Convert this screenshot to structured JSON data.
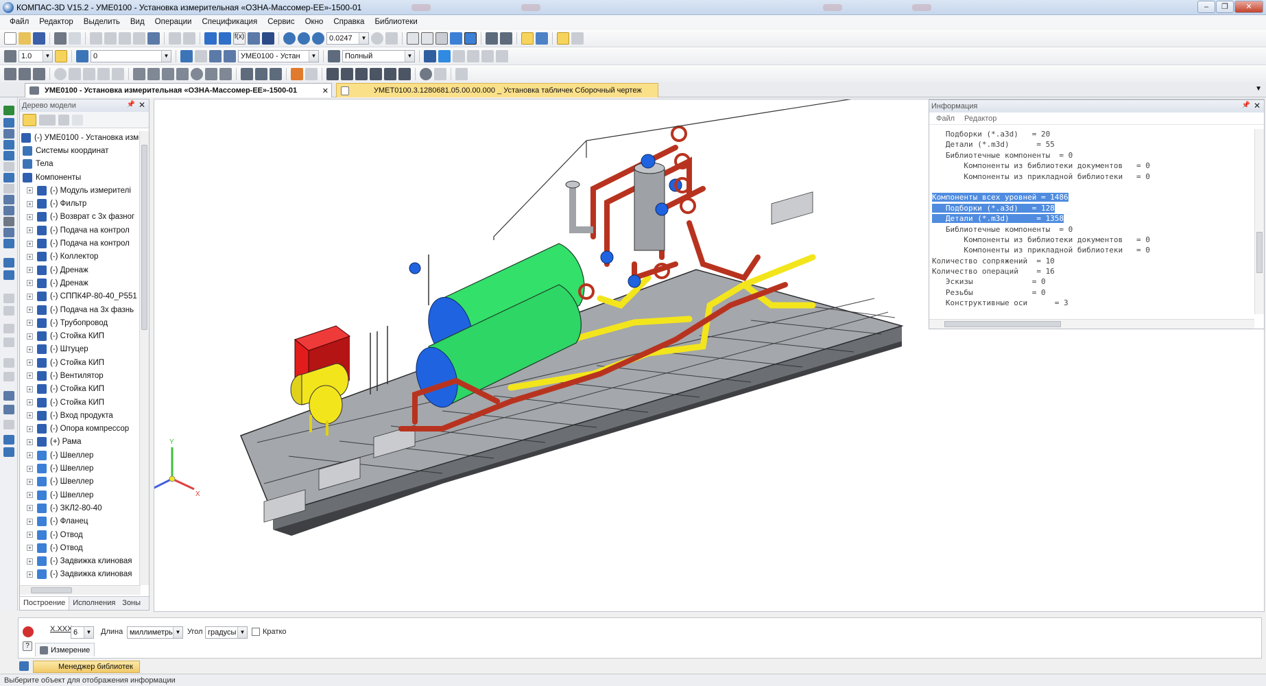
{
  "window": {
    "title": "КОМПАС-3D V15.2  - УМЕ0100 - Установка измерительная «ОЗНА-Массомер-ЕЕ»-1500-01"
  },
  "menu": [
    "Файл",
    "Редактор",
    "Выделить",
    "Вид",
    "Операции",
    "Спецификация",
    "Сервис",
    "Окно",
    "Справка",
    "Библиотеки"
  ],
  "toolbar1": {
    "zoom_value": "0.0247"
  },
  "toolbar2": {
    "step_value": "1.0",
    "layer_value": "0",
    "component_combo": "УМЕ0100 - Устан",
    "view_mode": "Полный"
  },
  "doc_tabs": [
    {
      "label": "УМЕ0100 - Установка измерительная «ОЗНА-Массомер-ЕЕ»-1500-01",
      "active": true
    },
    {
      "label": "УМЕТ0100.3.1280681.05.00.00.000 _ Установка табличек Сборочный чертеж",
      "active": false
    }
  ],
  "tree_panel": {
    "header": "Дерево модели",
    "items": [
      {
        "label": "(-) УМЕ0100 - Установка измер",
        "level": 0,
        "expander": "",
        "icon": "assembly-icon"
      },
      {
        "label": "Системы координат",
        "level": 1,
        "expander": "",
        "icon": "coordinate-systems-icon"
      },
      {
        "label": "Тела",
        "level": 1,
        "expander": "",
        "icon": "bodies-icon"
      },
      {
        "label": "Компоненты",
        "level": 1,
        "expander": "",
        "icon": "components-icon"
      },
      {
        "label": "(-) Модуль измерителі",
        "level": 2,
        "expander": "+",
        "icon": "assembly-icon"
      },
      {
        "label": "(-) Фильтр",
        "level": 2,
        "expander": "+",
        "icon": "assembly-icon"
      },
      {
        "label": "(-) Возврат с 3х фазног",
        "level": 2,
        "expander": "+",
        "icon": "assembly-icon"
      },
      {
        "label": "(-) Подача на контрол",
        "level": 2,
        "expander": "+",
        "icon": "assembly-icon"
      },
      {
        "label": "(-) Подача на контрол",
        "level": 2,
        "expander": "+",
        "icon": "assembly-icon"
      },
      {
        "label": "(-) Коллектор",
        "level": 2,
        "expander": "+",
        "icon": "assembly-icon"
      },
      {
        "label": "(-) Дренаж",
        "level": 2,
        "expander": "+",
        "icon": "assembly-icon"
      },
      {
        "label": "(-) Дренаж",
        "level": 2,
        "expander": "+",
        "icon": "assembly-icon"
      },
      {
        "label": "(-) СППК4Р-80-40_Р551",
        "level": 2,
        "expander": "+",
        "icon": "assembly-icon"
      },
      {
        "label": "(-) Подача на 3х фазнь",
        "level": 2,
        "expander": "+",
        "icon": "assembly-icon"
      },
      {
        "label": "(-) Трубопровод",
        "level": 2,
        "expander": "+",
        "icon": "assembly-icon"
      },
      {
        "label": "(-) Стойка КИП",
        "level": 2,
        "expander": "+",
        "icon": "assembly-icon"
      },
      {
        "label": "(-) Штуцер",
        "level": 2,
        "expander": "+",
        "icon": "assembly-icon"
      },
      {
        "label": "(-) Стойка КИП",
        "level": 2,
        "expander": "+",
        "icon": "assembly-icon"
      },
      {
        "label": "(-) Вентилятор",
        "level": 2,
        "expander": "+",
        "icon": "assembly-icon"
      },
      {
        "label": "(-) Стойка КИП",
        "level": 2,
        "expander": "+",
        "icon": "assembly-icon"
      },
      {
        "label": "(-) Стойка КИП",
        "level": 2,
        "expander": "+",
        "icon": "assembly-icon"
      },
      {
        "label": "(-) Вход продукта",
        "level": 2,
        "expander": "+",
        "icon": "assembly-icon"
      },
      {
        "label": "(-) Опора компрессор",
        "level": 2,
        "expander": "+",
        "icon": "assembly-icon"
      },
      {
        "label": "(+) Рама",
        "level": 2,
        "expander": "+",
        "icon": "assembly-icon"
      },
      {
        "label": "(-) Швеллер",
        "level": 2,
        "expander": "+",
        "icon": "part-icon"
      },
      {
        "label": "(-) Швеллер",
        "level": 2,
        "expander": "+",
        "icon": "part-icon"
      },
      {
        "label": "(-) Швеллер",
        "level": 2,
        "expander": "+",
        "icon": "part-icon"
      },
      {
        "label": "(-) Швеллер",
        "level": 2,
        "expander": "+",
        "icon": "part-icon"
      },
      {
        "label": "(-) ЗКЛ2-80-40",
        "level": 2,
        "expander": "+",
        "icon": "part-icon"
      },
      {
        "label": "(-) Фланец",
        "level": 2,
        "expander": "+",
        "icon": "part-icon"
      },
      {
        "label": "(-) Отвод",
        "level": 2,
        "expander": "+",
        "icon": "part-icon"
      },
      {
        "label": "(-) Отвод",
        "level": 2,
        "expander": "+",
        "icon": "part-icon"
      },
      {
        "label": "(-) Задвижка клиновая",
        "level": 2,
        "expander": "+",
        "icon": "part-icon"
      },
      {
        "label": "(-) Задвижка клиновая",
        "level": 2,
        "expander": "+",
        "icon": "part-icon"
      }
    ],
    "bottom_tabs": [
      "Построение",
      "Исполнения",
      "Зоны"
    ]
  },
  "info_panel": {
    "header": "Информация",
    "menu": [
      "Файл",
      "Редактор"
    ],
    "lines": [
      {
        "text": "   Подборки (*.a3d)   = 20",
        "selected": false
      },
      {
        "text": "   Детали (*.m3d)      = 55",
        "selected": false
      },
      {
        "text": "   Библиотечные компоненты  = 0",
        "selected": false
      },
      {
        "text": "       Компоненты из библиотеки документов   = 0",
        "selected": false
      },
      {
        "text": "       Компоненты из прикладной библиотеки   = 0",
        "selected": false
      },
      {
        "text": "",
        "selected": false
      },
      {
        "text": "Компоненты всех уровней = 1486",
        "selected": true
      },
      {
        "text": "   Подборки (*.a3d)   = 128",
        "selected": true
      },
      {
        "text": "   Детали (*.m3d)      = 1358",
        "selected": true
      },
      {
        "text": "   Библиотечные компоненты  = 0",
        "selected": false
      },
      {
        "text": "       Компоненты из библиотеки документов   = 0",
        "selected": false
      },
      {
        "text": "       Компоненты из прикладной библиотеки   = 0",
        "selected": false
      },
      {
        "text": "Количество сопряжений  = 10",
        "selected": false
      },
      {
        "text": "Количество операций    = 16",
        "selected": false
      },
      {
        "text": "   Эскизы             = 0",
        "selected": false
      },
      {
        "text": "   Резьбы             = 0",
        "selected": false
      },
      {
        "text": "   Конструктивные оси      = 3",
        "selected": false
      }
    ]
  },
  "triad": {
    "x": "X",
    "y": "Y",
    "z": "Z"
  },
  "property_bar": {
    "precision_label": "X.XXX",
    "precision_value": "6",
    "length_label": "Длина",
    "length_unit": "миллиметры",
    "angle_label": "Угол",
    "angle_unit": "градусы",
    "brief_label": "Кратко",
    "brief_checked": false,
    "measure_tab": "Измерение"
  },
  "library_bar": {
    "label": "Менеджер библиотек"
  },
  "status": {
    "text": "Выберите объект для отображения информации"
  },
  "colors": {
    "vessel_green": "#33e06a",
    "vessel_blue": "#1f63e0",
    "pipe_red": "#b8331f",
    "pipe_yellow": "#f3e51c",
    "box_red": "#e21c1c",
    "frame_gray": "#8f9296",
    "selection": "#4f8ce0"
  }
}
